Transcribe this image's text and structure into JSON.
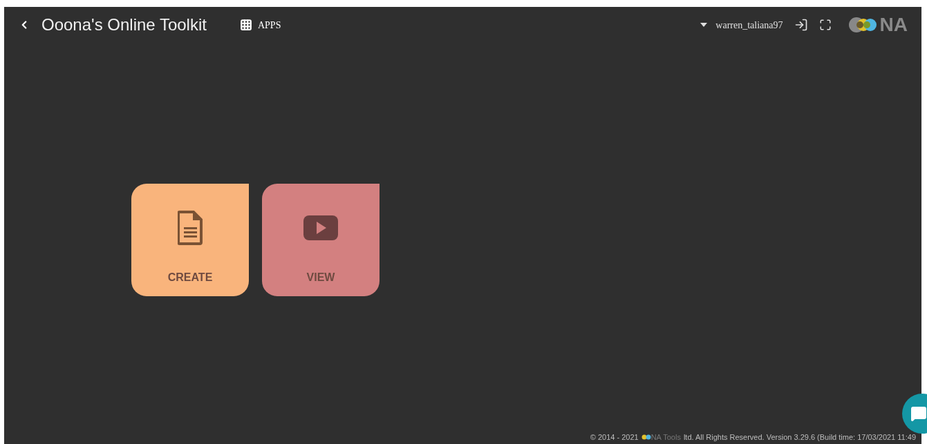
{
  "header": {
    "title": "Ooona's Online Toolkit",
    "apps_label": "APPS",
    "username": "warren_taliana97",
    "logo_text": "NA"
  },
  "tiles": [
    {
      "kind": "document",
      "label": "CREATE",
      "color": "#f9b47c"
    },
    {
      "kind": "video",
      "label": "VIEW",
      "color": "#d38080"
    }
  ],
  "footer": {
    "before": "© 2014 - 2021",
    "brand": "NA Tools",
    "after": "ltd. All Rights Reserved. Version 3.29.6 (Build time: 17/03/2021 11:49"
  }
}
